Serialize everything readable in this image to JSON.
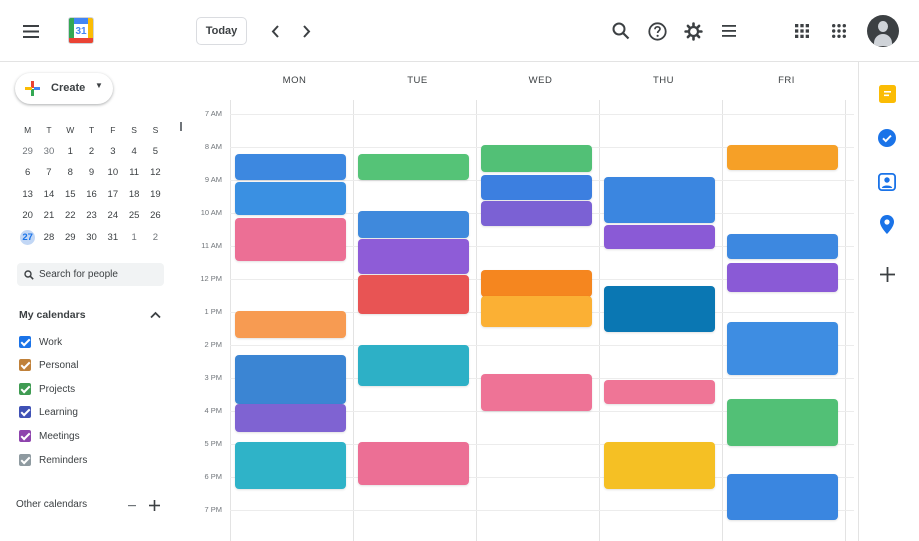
{
  "header": {
    "today_label": "Today",
    "logo_number": "31"
  },
  "sidebar": {
    "create_label": "Create",
    "mini_calendar": {
      "weekdays": [
        "M",
        "T",
        "W",
        "T",
        "F",
        "S",
        "S"
      ],
      "weeks": [
        [
          "29",
          "30",
          "1",
          "2",
          "3",
          "4",
          "5"
        ],
        [
          "6",
          "7",
          "8",
          "9",
          "10",
          "11",
          "12"
        ],
        [
          "13",
          "14",
          "15",
          "16",
          "17",
          "18",
          "19"
        ],
        [
          "20",
          "21",
          "22",
          "23",
          "24",
          "25",
          "26"
        ],
        [
          "27",
          "28",
          "29",
          "30",
          "31",
          "1",
          "2"
        ]
      ],
      "selected_day": "27"
    },
    "search_placeholder": "Search for people",
    "my_calendars_title": "My calendars",
    "calendars": [
      {
        "label": "Work",
        "color": "#1a73e8"
      },
      {
        "label": "Personal",
        "color": "#c0813a"
      },
      {
        "label": "Projects",
        "color": "#3f9b52"
      },
      {
        "label": "Learning",
        "color": "#3f51b5"
      },
      {
        "label": "Meetings",
        "color": "#8e44ad"
      },
      {
        "label": "Reminders",
        "color": "#8e9aa0"
      }
    ],
    "other_calendars_title": "Other calendars"
  },
  "grid": {
    "days": [
      "MON",
      "TUE",
      "WED",
      "THU",
      "FRI"
    ],
    "times": [
      "7 AM",
      "8 AM",
      "9 AM",
      "10 AM",
      "11 AM",
      "12 PM",
      "1 PM",
      "2 PM",
      "3 PM",
      "4 PM",
      "5 PM",
      "6 PM",
      "7 PM"
    ]
  },
  "events": [
    {
      "day": 0,
      "start": 8.2,
      "end": 9.0,
      "color": "#3d88e0"
    },
    {
      "day": 0,
      "start": 9.05,
      "end": 10.05,
      "color": "#3a90e2"
    },
    {
      "day": 0,
      "start": 10.15,
      "end": 11.45,
      "color": "#ec6f95"
    },
    {
      "day": 0,
      "start": 12.97,
      "end": 13.8,
      "color": "#f79b52"
    },
    {
      "day": 0,
      "start": 14.3,
      "end": 15.8,
      "color": "#3b85d3"
    },
    {
      "day": 0,
      "start": 15.8,
      "end": 16.65,
      "color": "#7f63d2"
    },
    {
      "day": 0,
      "start": 16.93,
      "end": 18.35,
      "color": "#2fb3c8"
    },
    {
      "day": 1,
      "start": 8.22,
      "end": 9.0,
      "color": "#55c377"
    },
    {
      "day": 1,
      "start": 9.95,
      "end": 10.75,
      "color": "#3f89dc"
    },
    {
      "day": 1,
      "start": 10.8,
      "end": 11.85,
      "color": "#8e5cd7"
    },
    {
      "day": 1,
      "start": 11.88,
      "end": 13.05,
      "color": "#e85454"
    },
    {
      "day": 1,
      "start": 14.0,
      "end": 15.25,
      "color": "#2db0c6"
    },
    {
      "day": 1,
      "start": 16.95,
      "end": 18.25,
      "color": "#ec6f95"
    },
    {
      "day": 1,
      "start": 19.0,
      "end": 19.1,
      "color": "#ffffff"
    },
    {
      "day": 2,
      "start": 7.95,
      "end": 8.75,
      "color": "#52c076"
    },
    {
      "day": 2,
      "start": 8.85,
      "end": 9.6,
      "color": "#3c7fe0"
    },
    {
      "day": 2,
      "start": 9.65,
      "end": 10.38,
      "color": "#7b61d4"
    },
    {
      "day": 2,
      "start": 11.72,
      "end": 12.55,
      "color": "#f5861f"
    },
    {
      "day": 2,
      "start": 12.5,
      "end": 13.45,
      "color": "#fbb034"
    },
    {
      "day": 2,
      "start": 14.87,
      "end": 16.0,
      "color": "#ee7396"
    },
    {
      "day": 3,
      "start": 8.9,
      "end": 10.3,
      "color": "#3b86e0"
    },
    {
      "day": 3,
      "start": 10.35,
      "end": 11.1,
      "color": "#8a5ad6"
    },
    {
      "day": 3,
      "start": 12.2,
      "end": 13.6,
      "color": "#0a77b3"
    },
    {
      "day": 3,
      "start": 15.05,
      "end": 15.8,
      "color": "#ef7596"
    },
    {
      "day": 3,
      "start": 16.95,
      "end": 18.35,
      "color": "#f5c024"
    },
    {
      "day": 4,
      "start": 7.95,
      "end": 8.7,
      "color": "#f6a027"
    },
    {
      "day": 4,
      "start": 10.65,
      "end": 11.4,
      "color": "#3d88e0"
    },
    {
      "day": 4,
      "start": 11.5,
      "end": 12.4,
      "color": "#8a5ad6"
    },
    {
      "day": 4,
      "start": 13.3,
      "end": 14.9,
      "color": "#3e8de2"
    },
    {
      "day": 4,
      "start": 15.65,
      "end": 17.05,
      "color": "#52c076"
    },
    {
      "day": 4,
      "start": 17.9,
      "end": 19.3,
      "color": "#3a86e0"
    }
  ],
  "icons": {
    "menu": "menu-icon",
    "prev": "chevron-left-icon",
    "next": "chevron-right-icon",
    "search": "search-icon",
    "help": "help-icon",
    "settings": "gear-icon",
    "view": "list-view-icon",
    "apps1": "apps-grid-icon",
    "apps2": "apps-grid-icon",
    "rail": [
      "keep-icon",
      "tasks-icon",
      "contacts-icon",
      "maps-icon",
      "add-icon"
    ]
  }
}
